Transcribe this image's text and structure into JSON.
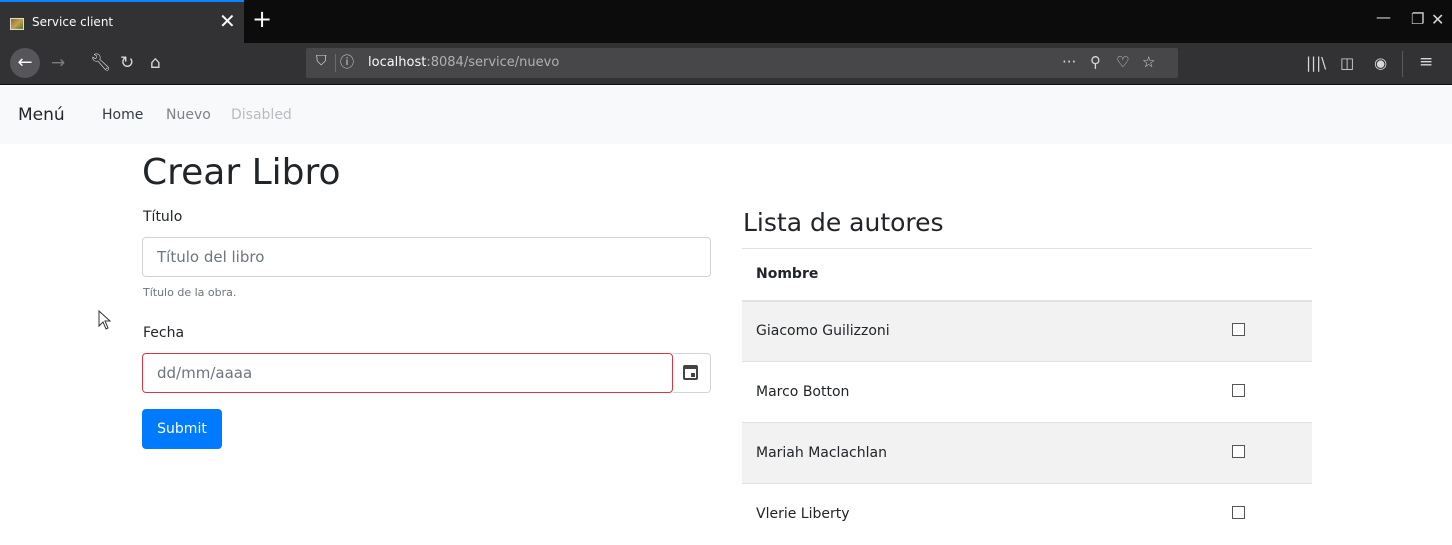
{
  "browser": {
    "tab_title": "Service client",
    "tab_close": "✕",
    "new_tab": "+",
    "url_host": "localhost",
    "url_path": ":8084/service/nuevo",
    "icons": [
      "back-arrow-icon",
      "forward-arrow-icon",
      "wrench-icon",
      "reload-icon",
      "home-icon",
      "shield-icon",
      "info-icon",
      "more-icon",
      "pin-icon",
      "pocket-icon",
      "star-icon",
      "library-icon",
      "sidebar-icon",
      "account-icon",
      "menu-icon"
    ]
  },
  "nav": {
    "brand": "Menú",
    "links": [
      "Home",
      "Nuevo",
      "Disabled"
    ]
  },
  "form": {
    "heading": "Crear Libro",
    "titulo_label": "Título",
    "titulo_placeholder": "Título del libro",
    "titulo_help": "Título de la obra.",
    "fecha_label": "Fecha",
    "fecha_placeholder": "dd/mm/aaaa",
    "submit_label": "Submit"
  },
  "authors": {
    "heading": "Lista de autores",
    "column": "Nombre",
    "rows": [
      {
        "name": "Giacomo Guilizzoni",
        "checked": false
      },
      {
        "name": "Marco Botton",
        "checked": false
      },
      {
        "name": "Mariah Maclachlan",
        "checked": false
      },
      {
        "name": "Vlerie Liberty",
        "checked": false
      }
    ]
  },
  "colors": {
    "primary": "#007bff",
    "invalid_border": "#dc3545",
    "chrome_dark": "#0c0c0d",
    "toolbar": "#323234"
  }
}
